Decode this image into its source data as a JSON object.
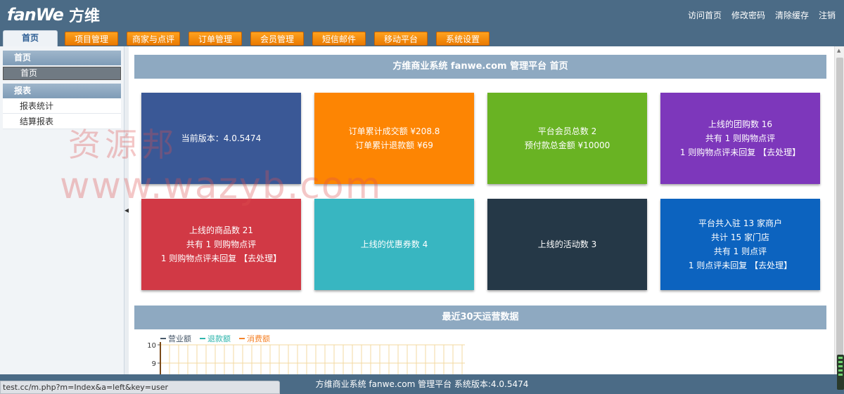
{
  "header": {
    "logo_en": "fanWe",
    "logo_cn": "方维",
    "links": [
      "访问首页",
      "修改密码",
      "清除缓存",
      "注销"
    ]
  },
  "nav": {
    "tabs": [
      "首页",
      "项目管理",
      "商家与点评",
      "订单管理",
      "会员管理",
      "短信邮件",
      "移动平台",
      "系统设置"
    ],
    "active_index": 0
  },
  "sidebar": {
    "groups": [
      {
        "title": "首页",
        "items": [
          "首页"
        ]
      },
      {
        "title": "报表",
        "items": [
          "报表统计",
          "结算报表"
        ]
      }
    ],
    "active_item": "首页"
  },
  "main": {
    "title": "方维商业系统 fanwe.com 管理平台 首页",
    "cards": [
      {
        "lines": [
          "当前版本：4.0.5474"
        ],
        "color": "#3a5896"
      },
      {
        "lines": [
          "订单累计成交额 ¥208.8",
          "订单累计退款额 ¥69"
        ],
        "color": "#fd8503"
      },
      {
        "lines": [
          "平台会员总数 2",
          "预付款总金额 ¥10000"
        ],
        "color": "#69b323"
      },
      {
        "lines": [
          "上线的团购数 16",
          "共有 1 则购物点评",
          "1 则购物点评未回复 【去处理】"
        ],
        "color": "#7d37bb"
      },
      {
        "lines": [
          "上线的商品数 21",
          "共有 1 则购物点评",
          "1 则购物点评未回复 【去处理】"
        ],
        "color": "#d13945"
      },
      {
        "lines": [
          "上线的优惠券数 4"
        ],
        "color": "#38b6c1"
      },
      {
        "lines": [
          "上线的活动数 3"
        ],
        "color": "#253847"
      },
      {
        "lines": [
          "平台共入驻 13 家商户",
          "共计 15 家门店",
          "共有 1 则点评",
          "1 则点评未回复 【去处理】"
        ],
        "color": "#0c63bf"
      }
    ],
    "ops_title": "最近30天运营数据"
  },
  "chart_data": {
    "type": "line",
    "legend": [
      {
        "name": "营业额",
        "color": "#4a5a6b"
      },
      {
        "name": "退款额",
        "color": "#2fb5ac"
      },
      {
        "name": "消费额",
        "color": "#f5832a"
      }
    ],
    "y_ticks_visible": [
      10,
      9
    ],
    "grid": true
  },
  "footer": {
    "text": "方维商业系统 fanwe.com 管理平台 系统版本:4.0.5474"
  },
  "statusbar": {
    "url": "test.cc/m.php?m=Index&a=left&key=user"
  },
  "watermark": {
    "line1": "资源邦",
    "line2": "www.wazyb.com"
  }
}
